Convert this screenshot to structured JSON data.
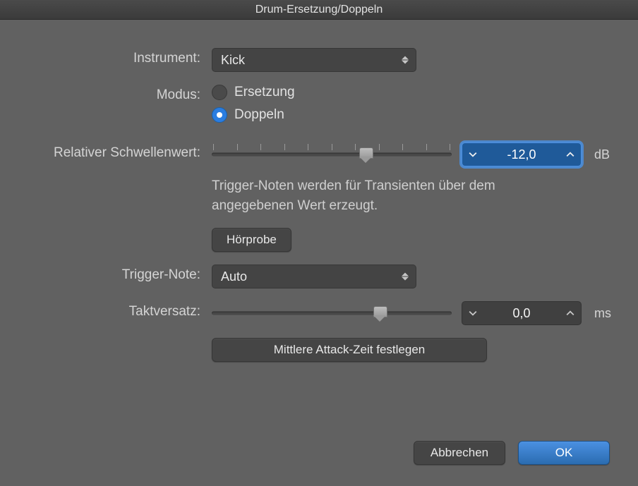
{
  "window": {
    "title": "Drum-Ersetzung/Doppeln"
  },
  "instrument": {
    "label": "Instrument:",
    "value": "Kick"
  },
  "mode": {
    "label": "Modus:",
    "options": {
      "replace": "Ersetzung",
      "double": "Doppeln"
    },
    "selected": "double"
  },
  "threshold": {
    "label": "Relativer Schwellenwert:",
    "value": "-12,0",
    "unit": "dB",
    "slider_percent": 64,
    "help": "Trigger-Noten werden für Transienten über dem angegebenen Wert erzeugt."
  },
  "prelisten": {
    "label": "Hörprobe"
  },
  "trigger_note": {
    "label": "Trigger-Note:",
    "value": "Auto"
  },
  "offset": {
    "label": "Taktversatz:",
    "value": "0,0",
    "unit": "ms",
    "slider_percent": 70
  },
  "set_attack": {
    "label": "Mittlere Attack-Zeit festlegen"
  },
  "footer": {
    "cancel": "Abbrechen",
    "ok": "OK"
  }
}
